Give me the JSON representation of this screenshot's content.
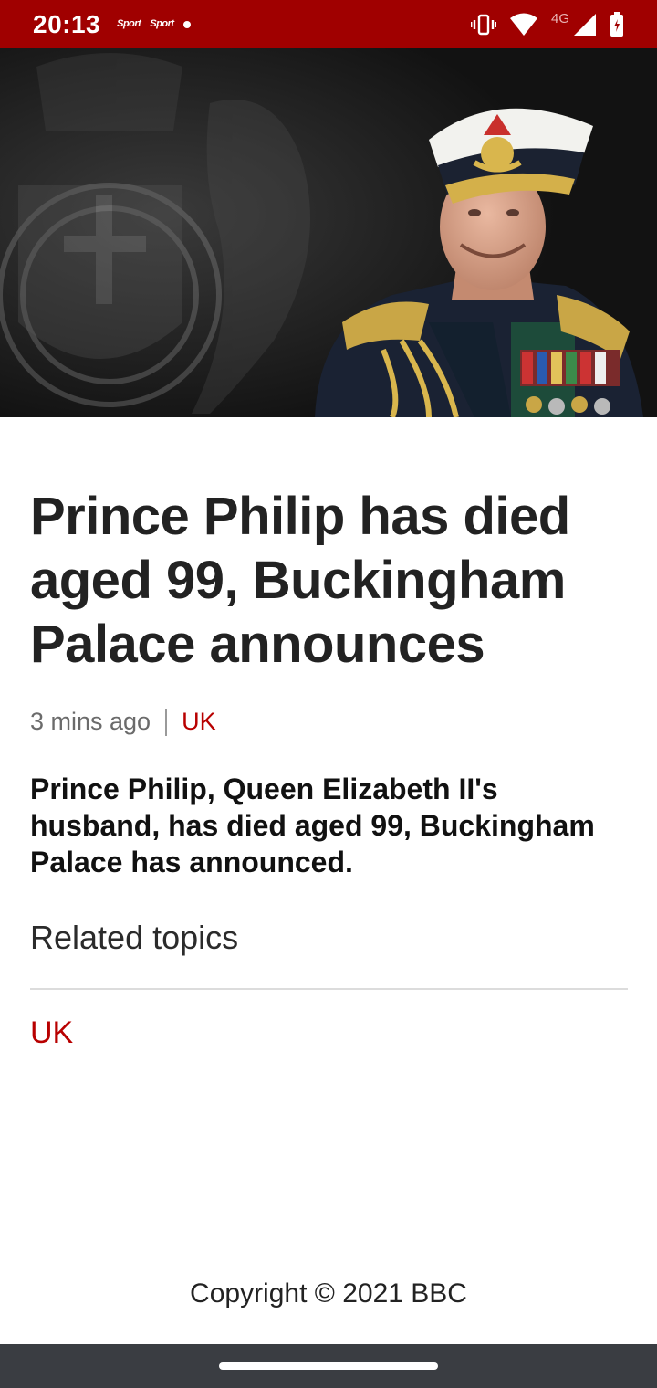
{
  "status_bar": {
    "time": "20:13",
    "notification_apps": [
      "Sport",
      "Sport"
    ],
    "network_label": "4G",
    "colors": {
      "background": "#a00000"
    }
  },
  "hero": {
    "description_icon": "portrait-image"
  },
  "article": {
    "headline": "Prince Philip has died aged 99, Buckingham Palace announces",
    "timestamp": "3 mins ago",
    "topic": "UK",
    "summary": "Prince Philip, Queen Elizabeth II's husband, has died aged 99, Buckingham Palace has announced."
  },
  "related": {
    "heading": "Related topics",
    "items": [
      {
        "label": "UK"
      }
    ]
  },
  "footer": {
    "copyright": "Copyright © 2021 BBC"
  },
  "theme": {
    "accent": "#b80000",
    "text": "#222222"
  }
}
